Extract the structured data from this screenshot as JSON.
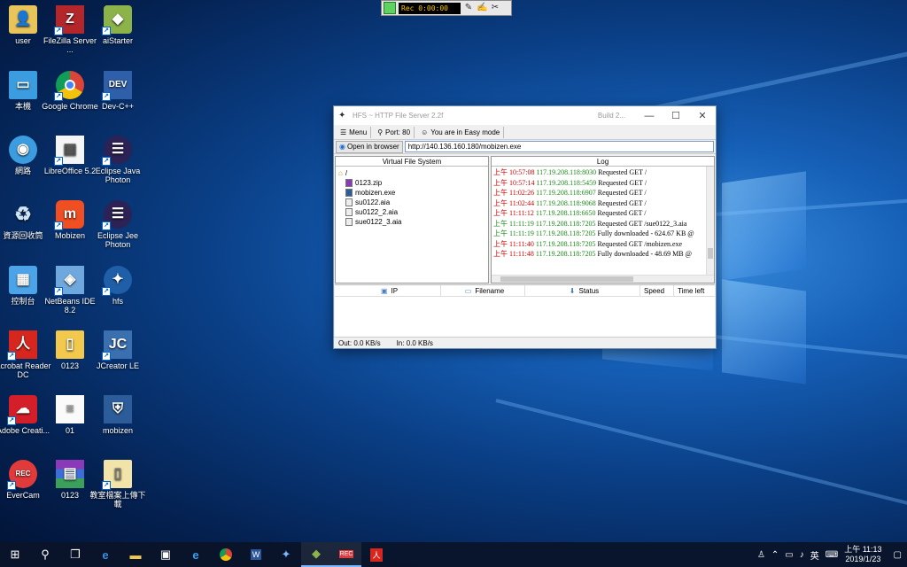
{
  "recorder": {
    "time_display": "Rec 0:00:00"
  },
  "desktop_icons": [
    {
      "label": "user",
      "icon": "user-folder-icon"
    },
    {
      "label": "FileZilla Server ...",
      "icon": "filezilla-icon"
    },
    {
      "label": "aiStarter",
      "icon": "aistarter-icon"
    },
    {
      "label": "本機",
      "icon": "this-pc-icon"
    },
    {
      "label": "Google Chrome",
      "icon": "chrome-icon"
    },
    {
      "label": "Dev-C++",
      "icon": "devcpp-icon"
    },
    {
      "label": "網路",
      "icon": "network-icon"
    },
    {
      "label": "LibreOffice 5.2",
      "icon": "libreoffice-icon"
    },
    {
      "label": "Eclipse Java Photon",
      "icon": "eclipse-icon"
    },
    {
      "label": "資源回收筒",
      "icon": "recycle-bin-icon"
    },
    {
      "label": "Mobizen",
      "icon": "mobizen-icon"
    },
    {
      "label": "Eclipse Jee Photon",
      "icon": "eclipse-jee-icon"
    },
    {
      "label": "控制台",
      "icon": "control-panel-icon"
    },
    {
      "label": "NetBeans IDE 8.2",
      "icon": "netbeans-icon"
    },
    {
      "label": "hfs",
      "icon": "hfs-icon"
    },
    {
      "label": "Acrobat Reader DC",
      "icon": "acrobat-icon"
    },
    {
      "label": "0123",
      "icon": "folder-icon"
    },
    {
      "label": "JCreator LE",
      "icon": "jcreator-icon"
    },
    {
      "label": "Adobe Creati...",
      "icon": "creative-cloud-icon"
    },
    {
      "label": "01",
      "icon": "document-icon"
    },
    {
      "label": "mobizen",
      "icon": "mobizen-file-icon"
    },
    {
      "label": "EverCam",
      "icon": "evercam-icon"
    },
    {
      "label": "0123",
      "icon": "winrar-icon"
    },
    {
      "label": "教室檔案上傳下載",
      "icon": "folder-icon"
    }
  ],
  "hfs": {
    "title": "HFS ~ HTTP File Server 2.2f",
    "build": "Build 2...",
    "menu_label": "Menu",
    "port_label": "Port: 80",
    "mode_label": "You are in Easy mode",
    "open_browser_label": "Open in browser",
    "url": "http://140.136.160.180/mobizen.exe",
    "vfs_header": "Virtual File System",
    "log_header": "Log",
    "vfs_root": "/",
    "vfs_files": [
      "0123.zip",
      "mobizen.exe",
      "su0122.aia",
      "su0122_2.aia",
      "sue0122_3.aia"
    ],
    "log": [
      {
        "time": "上午 10:57:08",
        "ip": "117.19.208.118:8030",
        "msg": "Requested GET /",
        "green": false
      },
      {
        "time": "上午 10:57:14",
        "ip": "117.19.208.118:5459",
        "msg": "Requested GET /",
        "green": false
      },
      {
        "time": "上午 11:02:26",
        "ip": "117.19.208.118:6907",
        "msg": "Requested GET /",
        "green": false
      },
      {
        "time": "上午 11:02:44",
        "ip": "117.19.208.118:9068",
        "msg": "Requested GET /",
        "green": false
      },
      {
        "time": "上午 11:11:12",
        "ip": "117.19.208.118:6650",
        "msg": "Requested GET /",
        "green": false
      },
      {
        "time": "上午 11:11:19",
        "ip": "117.19.208.118:7205",
        "msg": "Requested GET /sue0122_3.aia",
        "green": true
      },
      {
        "time": "上午 11:11:19",
        "ip": "117.19.208.118:7205",
        "msg": "Fully downloaded - 624.67 KB @",
        "green": true
      },
      {
        "time": "上午 11:11:40",
        "ip": "117.19.208.118:7205",
        "msg": "Requested GET /mobizen.exe",
        "green": false
      },
      {
        "time": "上午 11:11:48",
        "ip": "117.19.208.118:7205",
        "msg": "Fully downloaded - 48.69 MB @",
        "green": false
      }
    ],
    "columns": [
      "IP",
      "Filename",
      "Status",
      "Speed",
      "Time left"
    ],
    "status_out": "Out: 0.0 KB/s",
    "status_in": "In: 0.0 KB/s"
  },
  "tray": {
    "ime": "英",
    "time": "上午 11:13",
    "date": "2019/1/23"
  }
}
